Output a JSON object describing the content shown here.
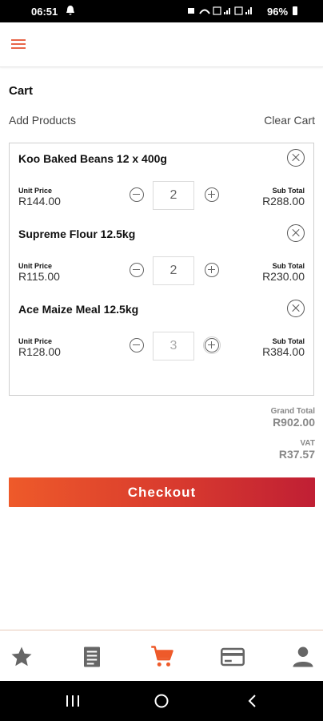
{
  "status_bar": {
    "time": "06:51",
    "battery": "96%"
  },
  "page": {
    "title": "Cart",
    "add_products": "Add Products",
    "clear_cart": "Clear Cart"
  },
  "labels": {
    "unit_price": "Unit Price",
    "sub_total": "Sub Total"
  },
  "items": [
    {
      "name": "Koo Baked Beans 12 x 400g",
      "unit_price": "R144.00",
      "quantity": "2",
      "sub_total": "R288.00"
    },
    {
      "name": "Supreme Flour 12.5kg",
      "unit_price": "R115.00",
      "quantity": "2",
      "sub_total": "R230.00"
    },
    {
      "name": "Ace Maize Meal 12.5kg",
      "unit_price": "R128.00",
      "quantity": "3",
      "sub_total": "R384.00"
    }
  ],
  "totals": {
    "grand_label": "Grand Total",
    "grand_value": "R902.00",
    "vat_label": "VAT",
    "vat_value": "R37.57"
  },
  "checkout_label": "Checkout",
  "colors": {
    "accent": "#ee5a2a",
    "accent_end": "#c01f34",
    "menu": "#e8674a",
    "nav_active": "#ee5a2a",
    "nav_inactive": "#666666"
  },
  "bottom_nav": [
    {
      "icon": "star-icon"
    },
    {
      "icon": "list-icon"
    },
    {
      "icon": "cart-icon",
      "active": true
    },
    {
      "icon": "credit-card-icon"
    },
    {
      "icon": "user-icon"
    }
  ]
}
